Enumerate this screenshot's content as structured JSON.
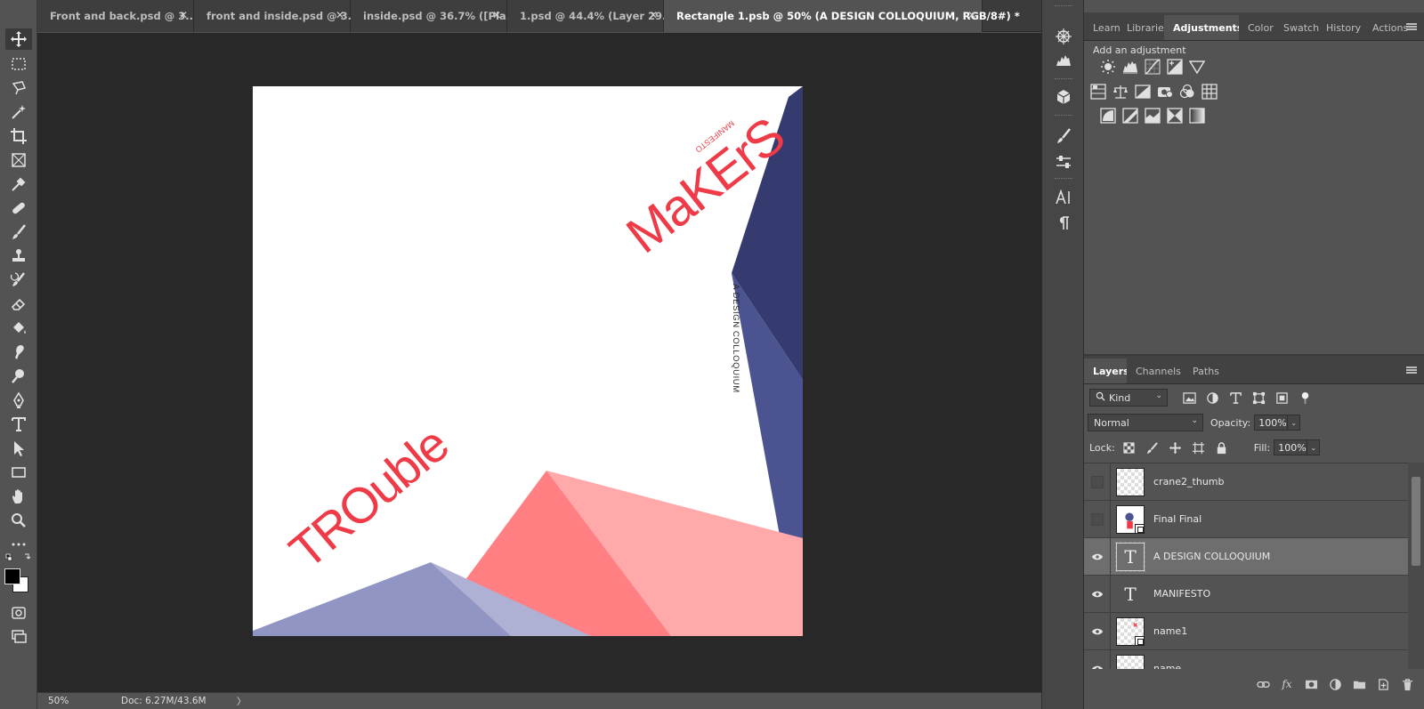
{
  "tabs": [
    {
      "label": "Front and back.psd @ 3...",
      "active": false
    },
    {
      "label": "front and inside.psd @ 3...",
      "active": false
    },
    {
      "label": "inside.psd @ 36.7% ([Pla...",
      "active": false
    },
    {
      "label": "1.psd @ 44.4% (Layer 29...",
      "active": false
    },
    {
      "label": "Rectangle 1.psb @ 50% (A DESIGN COLLOQUIUM, RGB/8#) *",
      "active": true
    }
  ],
  "tab_close_glyph": "✕",
  "tools": [
    {
      "name": "move-tool-icon"
    },
    {
      "name": "marquee-tool-icon"
    },
    {
      "name": "lasso-tool-icon"
    },
    {
      "name": "magic-wand-tool-icon"
    },
    {
      "name": "crop-tool-icon"
    },
    {
      "name": "frame-tool-icon"
    },
    {
      "name": "eyedropper-tool-icon"
    },
    {
      "name": "healing-brush-tool-icon"
    },
    {
      "name": "brush-tool-icon"
    },
    {
      "name": "clone-stamp-tool-icon"
    },
    {
      "name": "history-brush-tool-icon"
    },
    {
      "name": "eraser-tool-icon"
    },
    {
      "name": "paint-bucket-tool-icon"
    },
    {
      "name": "smudge-tool-icon"
    },
    {
      "name": "dodge-tool-icon"
    },
    {
      "name": "pen-tool-icon"
    },
    {
      "name": "type-tool-icon"
    },
    {
      "name": "path-selection-tool-icon"
    },
    {
      "name": "rectangle-tool-icon"
    },
    {
      "name": "hand-tool-icon"
    },
    {
      "name": "zoom-tool-icon"
    },
    {
      "name": "more-tools-icon"
    }
  ],
  "artwork": {
    "title_top": "MaKErS",
    "title_top_small": "MANIFESTO",
    "subtitle_vertical": "A DESIGN COLLOQUIUM",
    "title_bottom": "TROuble",
    "colors": {
      "navy": "#353b6e",
      "indigo": "#4b5490",
      "coral": "#ff7f82",
      "pink": "#ffa9ab",
      "lavender": "#9195c4",
      "lavender_light": "#aeb1d4",
      "red": "#ef3b47"
    }
  },
  "status": {
    "zoom": "50%",
    "doc": "Doc: 6.27M/43.6M",
    "arrow": "〉"
  },
  "adjust_panel": {
    "tabs": [
      {
        "label": "Learn",
        "active": false
      },
      {
        "label": "Librarie:",
        "active": false
      },
      {
        "label": "Adjustments",
        "active": true
      },
      {
        "label": "Color",
        "active": false
      },
      {
        "label": "Swatch",
        "active": false
      },
      {
        "label": "History",
        "active": false
      },
      {
        "label": "Actions",
        "active": false
      }
    ],
    "title": "Add an adjustment",
    "icons": [
      "brightness-contrast-icon",
      "levels-icon",
      "curves-icon",
      "exposure-icon",
      "vibrance-icon",
      "hue-saturation-icon",
      "color-balance-icon",
      "black-white-icon",
      "photo-filter-icon",
      "channel-mixer-icon",
      "color-lookup-icon",
      "invert-icon",
      "posterize-icon",
      "threshold-icon",
      "selective-color-icon",
      "gradient-map-icon"
    ]
  },
  "layers_panel": {
    "tabs": [
      {
        "label": "Layers",
        "active": true
      },
      {
        "label": "Channels",
        "active": false
      },
      {
        "label": "Paths",
        "active": false
      }
    ],
    "filter_kind": "Kind",
    "blend_mode": "Normal",
    "opacity_label": "Opacity:",
    "opacity_value": "100%",
    "lock_label": "Lock:",
    "fill_label": "Fill:",
    "fill_value": "100%",
    "layers": [
      {
        "name": "crane2_thumb",
        "visible": false,
        "kind": "pixel",
        "selected": false
      },
      {
        "name": "Final Final",
        "visible": false,
        "kind": "smart",
        "selected": false
      },
      {
        "name": "A DESIGN COLLOQUIUM",
        "visible": true,
        "kind": "text",
        "selected": true
      },
      {
        "name": "MANIFESTO",
        "visible": true,
        "kind": "text",
        "selected": false
      },
      {
        "name": "name1",
        "visible": true,
        "kind": "smart",
        "selected": false
      },
      {
        "name": "name",
        "visible": true,
        "kind": "smart",
        "selected": false
      }
    ],
    "footer_fx": "fx"
  }
}
